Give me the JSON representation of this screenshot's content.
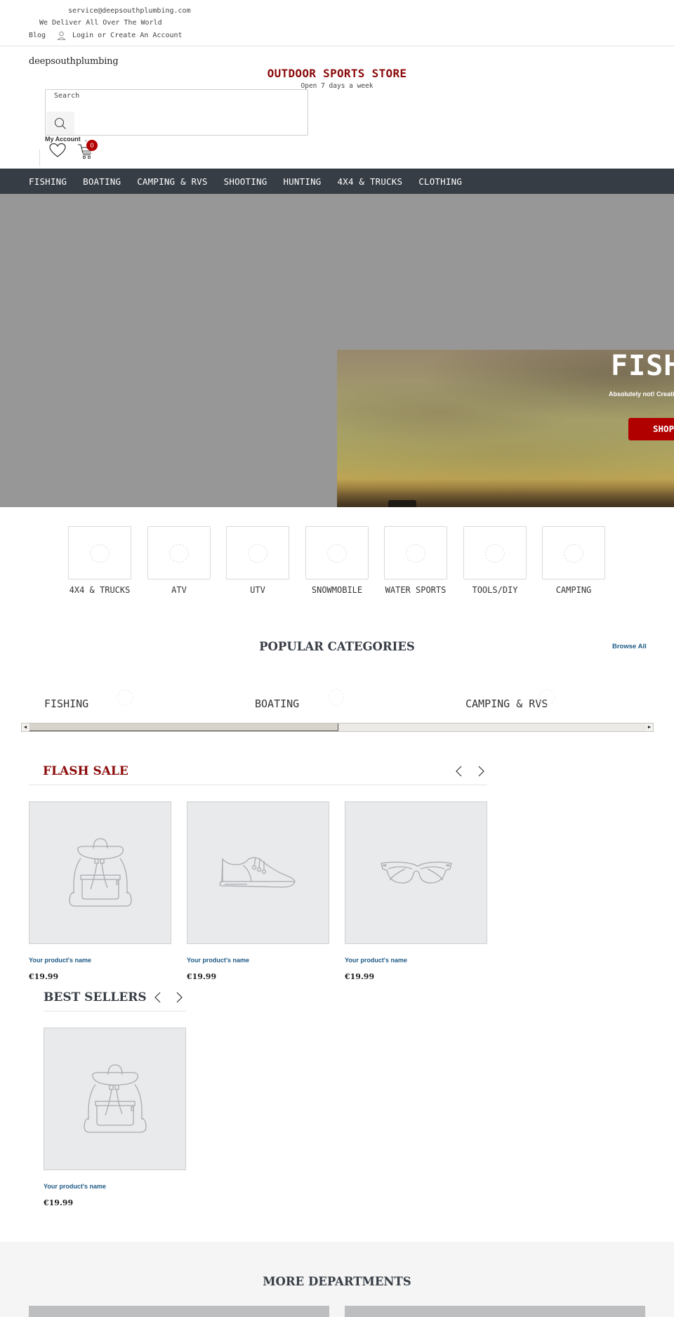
{
  "topbar": {
    "email": "service@deepsouthplumbing.com",
    "delivery_text": "We Deliver All Over The World",
    "blog_label": "Blog",
    "login_label": "Login or Create An Account"
  },
  "header": {
    "logo": "deepsouthplumbing",
    "store_title": "OUTDOOR SPORTS STORE",
    "store_subtitle": "Open 7 days a week",
    "search_label": "Search",
    "my_account_label": "My Account",
    "cart_count": "0"
  },
  "nav": {
    "items": [
      "FISHING",
      "BOATING",
      "CAMPING & RVS",
      "SHOOTING",
      "HUNTING",
      "4X4 & TRUCKS",
      "CLOTHING"
    ]
  },
  "hero": {
    "title": "FISHING",
    "subtitle": "Absolutely not! Creating",
    "button_label": "SHOP NOW"
  },
  "categories": {
    "items": [
      "4X4 & TRUCKS",
      "ATV",
      "UTV",
      "SNOWMOBILE",
      "WATER SPORTS",
      "TOOLS/DIY",
      "CAMPING"
    ]
  },
  "popular": {
    "title": "POPULAR CATEGORIES",
    "browse_all_label": "Browse All",
    "items": [
      "FISHING",
      "BOATING",
      "CAMPING & RVS"
    ]
  },
  "flash_sale": {
    "title": "FLASH SALE",
    "products": [
      {
        "name": "Your product's name",
        "price": "€19.99",
        "image": "backpack"
      },
      {
        "name": "Your product's name",
        "price": "€19.99",
        "image": "sneaker"
      },
      {
        "name": "Your product's name",
        "price": "€19.99",
        "image": "sunglasses"
      }
    ]
  },
  "best_sellers": {
    "title": "BEST SELLERS",
    "products": [
      {
        "name": "Your product's name",
        "price": "€19.99",
        "image": "backpack"
      }
    ]
  },
  "more_departments": {
    "title": "MORE DEPARTMENTS"
  },
  "colors": {
    "brand_red": "#8b0a0a",
    "button_red": "#b00000",
    "nav_bg": "#373d45",
    "link_blue": "#1e5a86"
  }
}
